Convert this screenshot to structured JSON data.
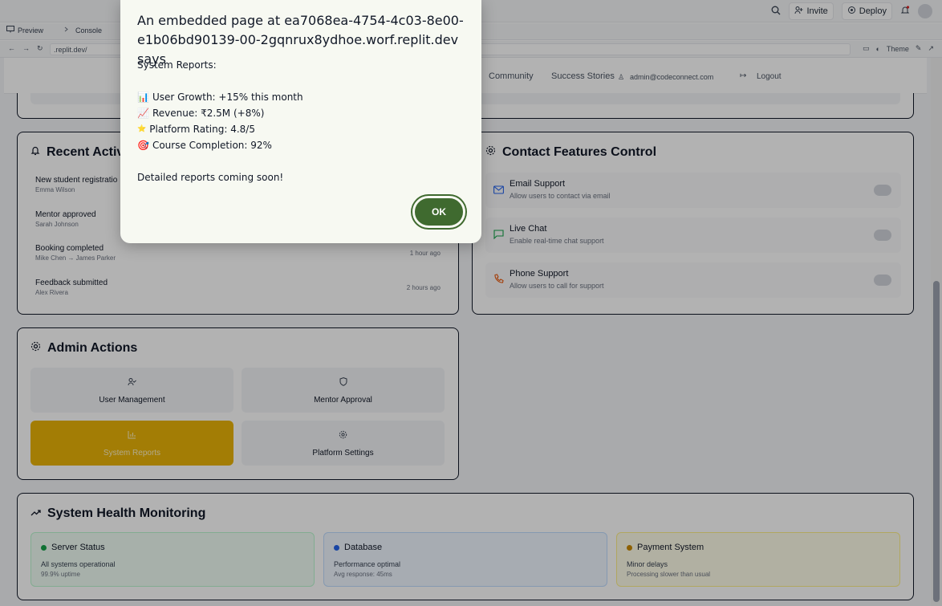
{
  "replit": {
    "invite_label": "Invite",
    "deploy_label": "Deploy",
    "tabs": [
      {
        "label": "Preview"
      },
      {
        "label": "Console"
      }
    ],
    "url": ".replit.dev/",
    "theme_label": "Theme"
  },
  "app_nav": {
    "links": [
      "Community",
      "Success Stories"
    ],
    "user_email": "admin@codeconnect.com",
    "logout_label": "Logout"
  },
  "recent_activity": {
    "title": "Recent Activi",
    "items": [
      {
        "title": "New student registratio",
        "subtitle": "Emma Wilson",
        "time": ""
      },
      {
        "title": "Mentor approved",
        "subtitle": "Sarah Johnson",
        "time": ""
      },
      {
        "title": "Booking completed",
        "subtitle": "Mike Chen → James Parker",
        "time": "1 hour ago"
      },
      {
        "title": "Feedback submitted",
        "subtitle": "Alex Rivera",
        "time": "2 hours ago"
      }
    ]
  },
  "contact_features": {
    "title": "Contact Features Control",
    "items": [
      {
        "title": "Email Support",
        "subtitle": "Allow users to contact via email",
        "icon": "mail-icon"
      },
      {
        "title": "Live Chat",
        "subtitle": "Enable real-time chat support",
        "icon": "chat-icon"
      },
      {
        "title": "Phone Support",
        "subtitle": "Allow users to call for support",
        "icon": "phone-icon"
      }
    ]
  },
  "admin_actions": {
    "title": "Admin Actions",
    "items": [
      {
        "label": "User Management"
      },
      {
        "label": "Mentor Approval"
      },
      {
        "label": "System Reports"
      },
      {
        "label": "Platform Settings"
      }
    ]
  },
  "system_health": {
    "title": "System Health Monitoring",
    "items": [
      {
        "name": "Server Status",
        "status": "All systems operational",
        "detail": "99.9% uptime",
        "color": "#16a34a"
      },
      {
        "name": "Database",
        "status": "Performance optimal",
        "detail": "Avg response: 45ms",
        "color": "#2563eb"
      },
      {
        "name": "Payment System",
        "status": "Minor delays",
        "detail": "Processing slower than usual",
        "color": "#ca8a04"
      }
    ]
  },
  "dialog": {
    "title": "An embedded page at ea7068ea-4754-4c03-8e00-e1b06bd90139-00-2gqnrux8ydhoe.worf.replit.dev says",
    "heading": "System Reports:",
    "lines": [
      {
        "icon": "📊",
        "text": "User Growth: +15% this month"
      },
      {
        "icon": "📈",
        "text": "Revenue: ₹2.5M (+8%)"
      },
      {
        "icon": "⭐",
        "text": "Platform Rating: 4.8/5"
      },
      {
        "icon": "🎯",
        "text": "Course Completion: 92%"
      }
    ],
    "footer": "Detailed reports coming soon!",
    "ok_label": "OK"
  }
}
